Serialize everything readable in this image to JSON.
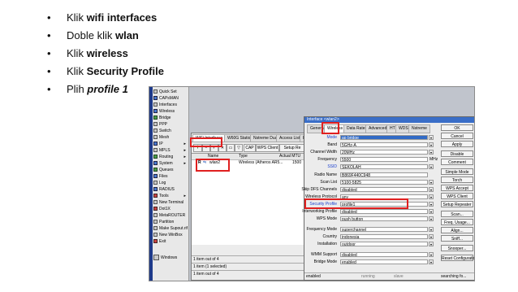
{
  "bullets": [
    {
      "plain": "Klik ",
      "bold": "wifi interfaces"
    },
    {
      "plain": "Doble klik ",
      "bold": "wlan"
    },
    {
      "plain": "Klik ",
      "bold": "wireless"
    },
    {
      "plain": "Klik ",
      "bold": "Security Profile"
    },
    {
      "plain": "Plih ",
      "bolditalic": "profile 1"
    }
  ],
  "bullet_char": "•",
  "sidebar": {
    "items": [
      {
        "label": "Quick Set",
        "icon": "quickset-icon"
      },
      {
        "label": "CAPsMAN",
        "icon": "capsman-icon"
      },
      {
        "label": "Interfaces",
        "icon": "interfaces-icon"
      },
      {
        "label": "Wireless",
        "icon": "wireless-icon"
      },
      {
        "label": "Bridge",
        "icon": "bridge-icon"
      },
      {
        "label": "PPP",
        "icon": "ppp-icon"
      },
      {
        "label": "Switch",
        "icon": "switch-icon"
      },
      {
        "label": "Mesh",
        "icon": "mesh-icon"
      },
      {
        "label": "IP",
        "icon": "ip-icon",
        "submenu": true
      },
      {
        "label": "MPLS",
        "icon": "mpls-icon",
        "submenu": true
      },
      {
        "label": "Routing",
        "icon": "routing-icon",
        "submenu": true
      },
      {
        "label": "System",
        "icon": "system-icon",
        "submenu": true
      },
      {
        "label": "Queues",
        "icon": "queues-icon"
      },
      {
        "label": "Files",
        "icon": "files-icon"
      },
      {
        "label": "Log",
        "icon": "log-icon"
      },
      {
        "label": "RADIUS",
        "icon": "radius-icon"
      },
      {
        "label": "Tools",
        "icon": "tools-icon",
        "submenu": true
      },
      {
        "label": "New Terminal",
        "icon": "terminal-icon"
      },
      {
        "label": "Dot1X",
        "icon": "dot1x-icon"
      },
      {
        "label": "MetaROUTER",
        "icon": "metarouter-icon"
      },
      {
        "label": "Partition",
        "icon": "partition-icon"
      },
      {
        "label": "Make Supout.rif",
        "icon": "supout-icon"
      },
      {
        "label": "New WinBox",
        "icon": "winbox-icon"
      },
      {
        "label": "Exit",
        "icon": "exit-icon"
      }
    ],
    "windows_label": "Windows"
  },
  "wifi_window": {
    "tabs": [
      "WiFi Interfaces",
      "W60G Station",
      "Nstreme Dual",
      "Access List",
      "Regis"
    ],
    "toolbar": {
      "cap": "CAP",
      "wps_client": "WPS Client",
      "setup_re": "Setup Re"
    },
    "columns": [
      "Name",
      "Type",
      "Actual MTU",
      "Tx"
    ],
    "rows": [
      {
        "flag": "R",
        "name": "wlan2",
        "type": "Wireless (Atheros AR5...",
        "mtu": "1500"
      }
    ],
    "status": [
      "1 item out of 4",
      "1 item (1 selected)",
      "1 item out of 4"
    ]
  },
  "interface_dialog": {
    "title": "Interface <wlan2>",
    "tabs": [
      "General",
      "Wireless",
      "Data Rates",
      "Advanced",
      "HT",
      "WDS",
      "Nstreme"
    ],
    "fields": [
      {
        "label": "Mode",
        "value": "ap bridge",
        "dropdown": true,
        "highlight": true,
        "blue": true
      },
      {
        "label": "Band",
        "value": "5GHz-A",
        "dropdown": true
      },
      {
        "label": "Channel Width",
        "value": "20MHz",
        "dropdown": true
      },
      {
        "label": "Frequency",
        "value": "5500",
        "unit": "MHz"
      },
      {
        "label": "SSID",
        "value": "SEKOLAH",
        "dropdown": true,
        "blue": true
      },
      {
        "label": "Radio Name",
        "value": "B869F440C948"
      },
      {
        "label": "Scan List",
        "value": "5100-5825",
        "dropdown": true
      },
      {
        "label": "Skip DFS Channels",
        "value": "disabled",
        "dropdown": true
      },
      {
        "label": "Wireless Protocol",
        "value": "any",
        "dropdown": true
      },
      {
        "label": "Security Profile",
        "value": "profile1",
        "dropdown": true,
        "blue": true
      },
      {
        "label": "Interworking Profile",
        "value": "disabled",
        "dropdown": true
      },
      {
        "label": "WPS Mode",
        "value": "push button",
        "dropdown": true
      },
      {
        "label": "Frequency Mode",
        "value": "superchannel",
        "dropdown": true
      },
      {
        "label": "Country",
        "value": "indonesia",
        "dropdown": true
      },
      {
        "label": "Installation",
        "value": "outdoor",
        "dropdown": true
      },
      {
        "label": "WMM Support",
        "value": "disabled",
        "dropdown": true
      },
      {
        "label": "Bridge Mode",
        "value": "enabled",
        "dropdown": true
      }
    ],
    "buttons": [
      "OK",
      "Cancel",
      "Apply",
      "Disable",
      "Comment",
      "Simple Mode",
      "Torch",
      "WPS Accept",
      "WPS Client",
      "Setup Repeater",
      "Scan...",
      "Freq. Usage...",
      "Align...",
      "Sniff...",
      "Snooper...",
      "Reset Configuration"
    ],
    "status": {
      "left": "enabled",
      "mid1": "running",
      "mid2": "slave",
      "right": "searching fo..."
    }
  },
  "colors": {
    "highlight_box": "#e02020",
    "accent": "#316ac5"
  }
}
